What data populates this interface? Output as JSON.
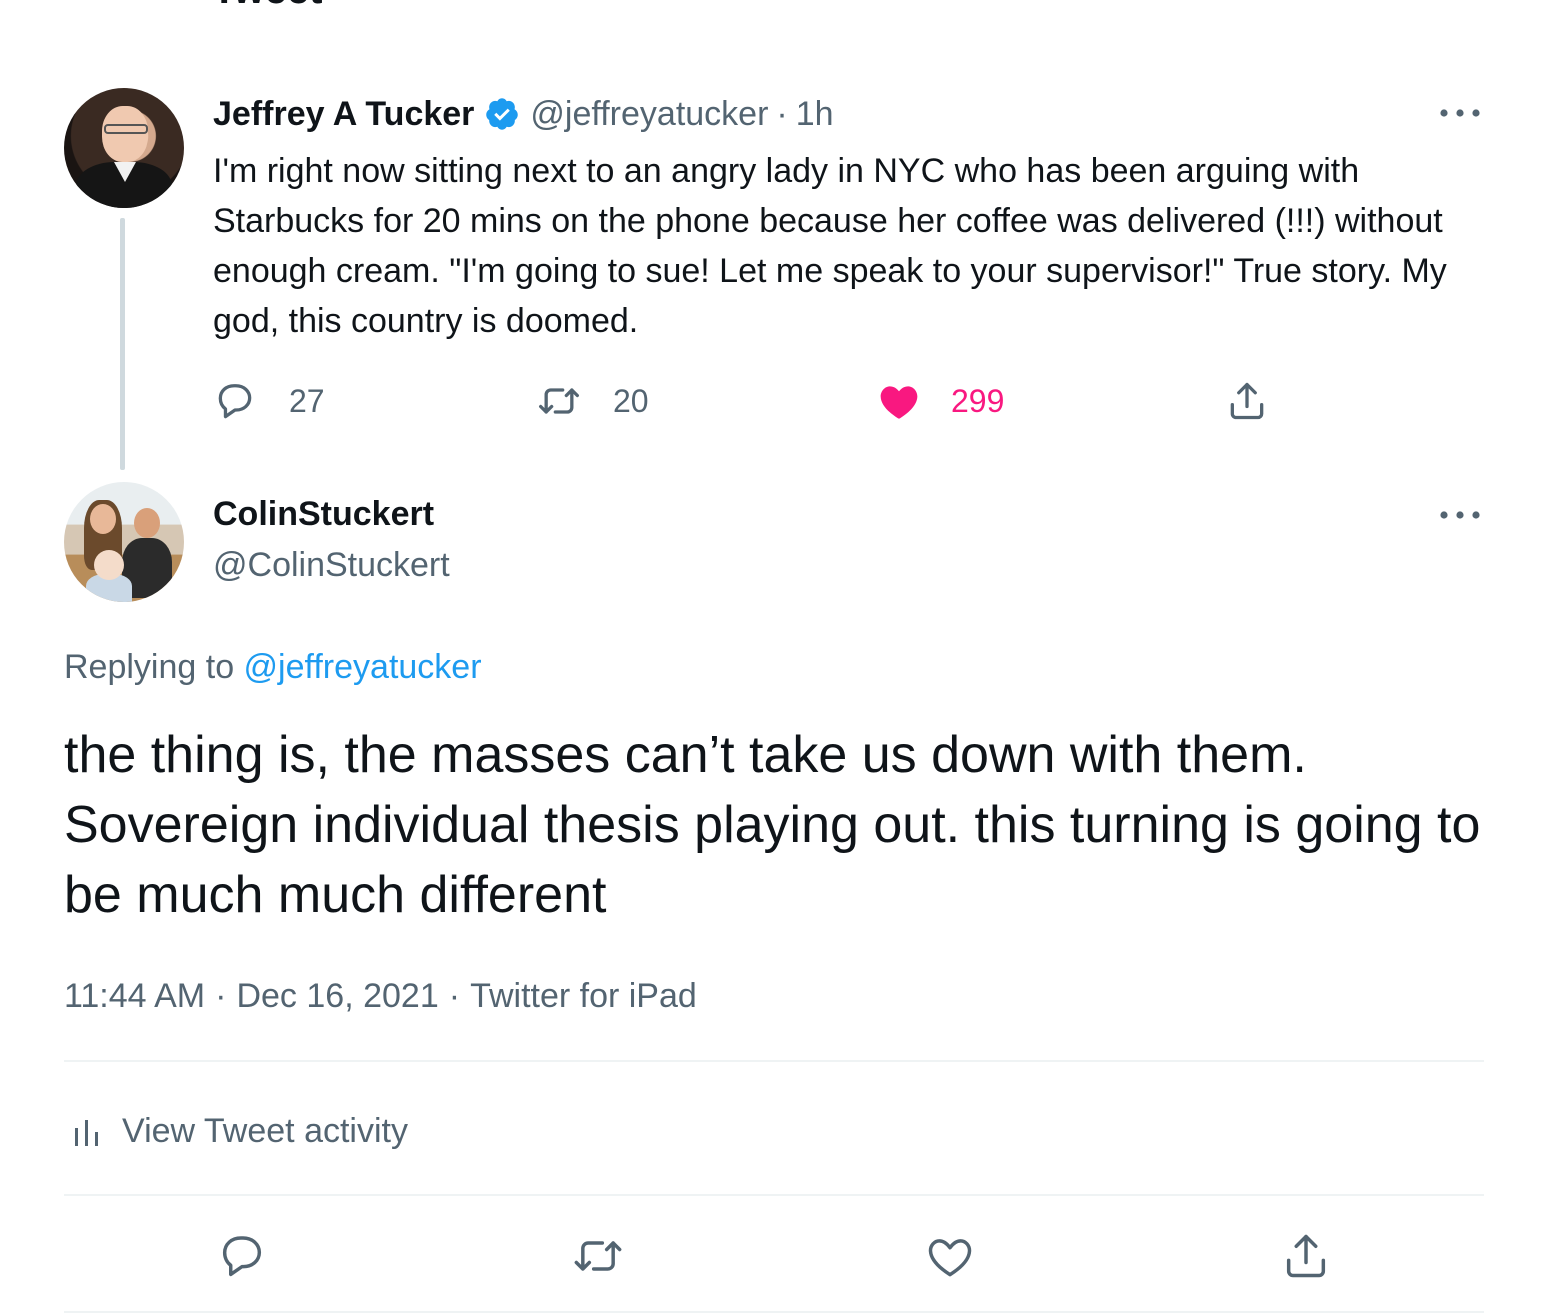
{
  "header": {
    "title": "Tweet"
  },
  "original_tweet": {
    "author_name": "Jeffrey A Tucker",
    "verified": true,
    "handle": "@jeffreyatucker",
    "separator": "·",
    "time": "1h",
    "text": "I'm right now sitting next to an angry lady in NYC who has been arguing with Starbucks for 20 mins on the phone because her coffee was delivered (!!!) without enough cream. \"I'm going to sue! Let me speak to your supervisor!\" True story. My god, this country is doomed.",
    "stats": {
      "replies": "27",
      "retweets": "20",
      "likes": "299"
    },
    "liked": true
  },
  "reply_tweet": {
    "author_name": "ColinStuckert",
    "handle": "@ColinStuckert",
    "replying_prefix": "Replying to ",
    "replying_to": "@jeffreyatucker",
    "text": "the thing is, the masses can’t take us down with them. Sovereign individual thesis playing out. this turning is going to be much much different",
    "time": "11:44 AM",
    "separator": "·",
    "date": "Dec 16, 2021",
    "source": "Twitter for iPad"
  },
  "activity": {
    "label": "View Tweet activity"
  },
  "colors": {
    "text": "#0f1419",
    "secondary": "#536471",
    "link": "#1d9bf0",
    "like": "#f91880",
    "verified": "#1d9bf0",
    "divider": "#eff3f4"
  },
  "icons": [
    "back-arrow-icon",
    "verified-badge-icon",
    "more-icon",
    "reply-icon",
    "retweet-icon",
    "heart-icon",
    "share-icon",
    "analytics-icon"
  ]
}
